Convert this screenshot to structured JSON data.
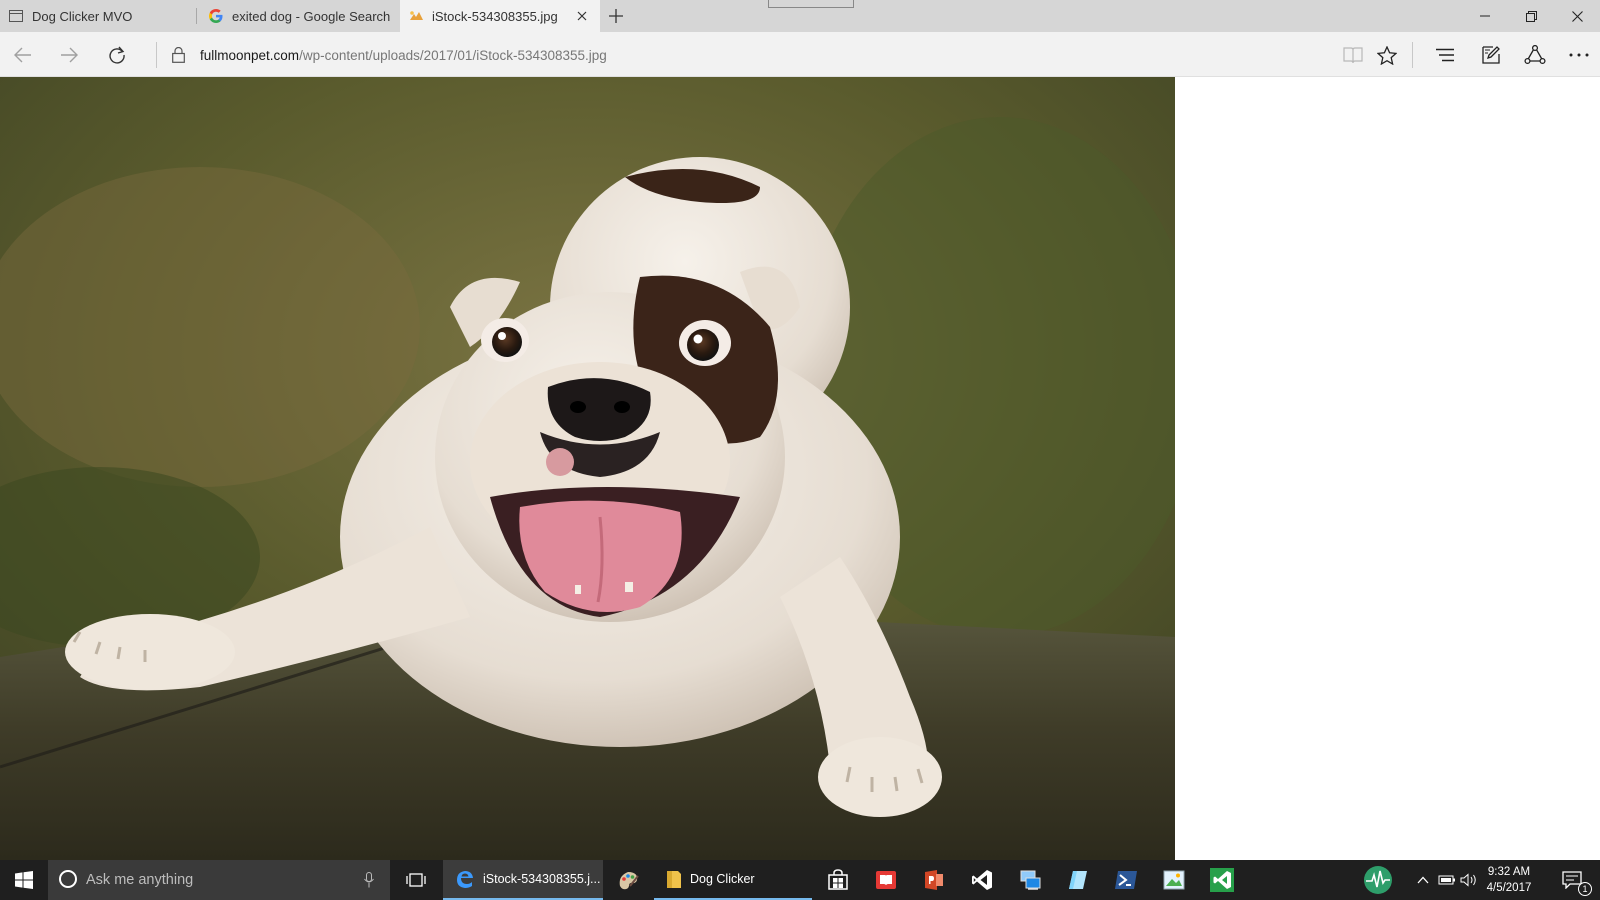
{
  "browser": {
    "tabs": [
      {
        "title": "Dog Clicker MVO",
        "icon": "page-icon",
        "active": false
      },
      {
        "title": "exited dog - Google Search",
        "icon": "google-icon",
        "active": false
      },
      {
        "title": "iStock-534308355.jpg",
        "icon": "image-icon",
        "active": true
      }
    ],
    "address": {
      "domain": "fullmoonpet.com",
      "path": "/wp-content/uploads/2017/01/iStock-534308355.jpg"
    }
  },
  "content": {
    "image_subject": "dog-photo"
  },
  "taskbar": {
    "search_placeholder": "Ask me anything",
    "apps": [
      {
        "label": "iStock-534308355.j...",
        "icon": "edge-icon",
        "active": true
      },
      {
        "label": "Dog Clicker",
        "icon": "folder-icon",
        "active": false
      }
    ],
    "clock": {
      "time": "9:32 AM",
      "date": "4/5/2017"
    },
    "notification_count": "1"
  }
}
